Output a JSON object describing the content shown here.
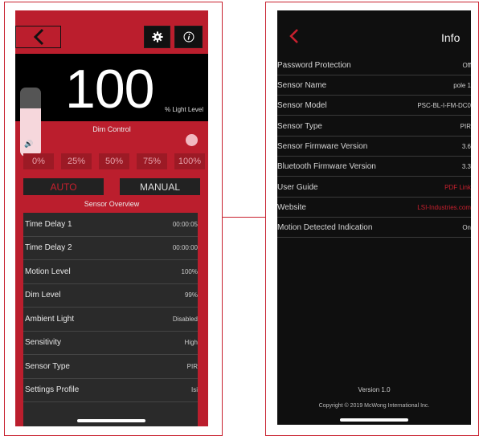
{
  "left_screen": {
    "icons": {
      "back": "chevron-left-icon",
      "settings": "gear-icon",
      "info": "info-icon",
      "speaker": "speaker-icon"
    },
    "big_value": "100",
    "big_unit": "% Light Level",
    "brightness_fraction": 0.7,
    "dim_control_label": "Dim Control",
    "percent_buttons": [
      "0%",
      "25%",
      "50%",
      "75%",
      "100%"
    ],
    "mode_auto": "AUTO",
    "mode_manual": "MANUAL",
    "overview_label": "Sensor Overview",
    "rows": [
      {
        "label": "Time Delay 1",
        "value": "00:00:05"
      },
      {
        "label": "Time Delay 2",
        "value": "00:00:00"
      },
      {
        "label": "Motion Level",
        "value": "100%"
      },
      {
        "label": "Dim Level",
        "value": "99%"
      },
      {
        "label": "Ambient Light",
        "value": "Disabled"
      },
      {
        "label": "Sensitivity",
        "value": "High"
      },
      {
        "label": "Sensor Type",
        "value": "PIR"
      },
      {
        "label": "Settings Profile",
        "value": "Isi"
      }
    ]
  },
  "right_screen": {
    "title": "Info",
    "icons": {
      "back": "chevron-left-icon"
    },
    "rows": [
      {
        "label": "Password Protection",
        "value": "Off"
      },
      {
        "label": "Sensor Name",
        "value": "pole 1"
      },
      {
        "label": "Sensor Model",
        "value": "PSC-BL-I-FM-DC0"
      },
      {
        "label": "Sensor Type",
        "value": "PIR"
      },
      {
        "label": "Sensor Firmware Version",
        "value": "3.6"
      },
      {
        "label": "Bluetooth Firmware Version",
        "value": "3.3"
      },
      {
        "label": "User Guide",
        "value": "PDF Link"
      },
      {
        "label": "Website",
        "value": "LSI-Industries.com"
      },
      {
        "label": "Motion Detected Indication",
        "value": "On"
      }
    ],
    "version": "Version 1.0",
    "copyright": "Copyright © 2019 McWong International Inc."
  },
  "colors": {
    "brand_red": "#bb1e2d",
    "accent_red": "#c8202e",
    "dark": "#0f0f0f"
  }
}
